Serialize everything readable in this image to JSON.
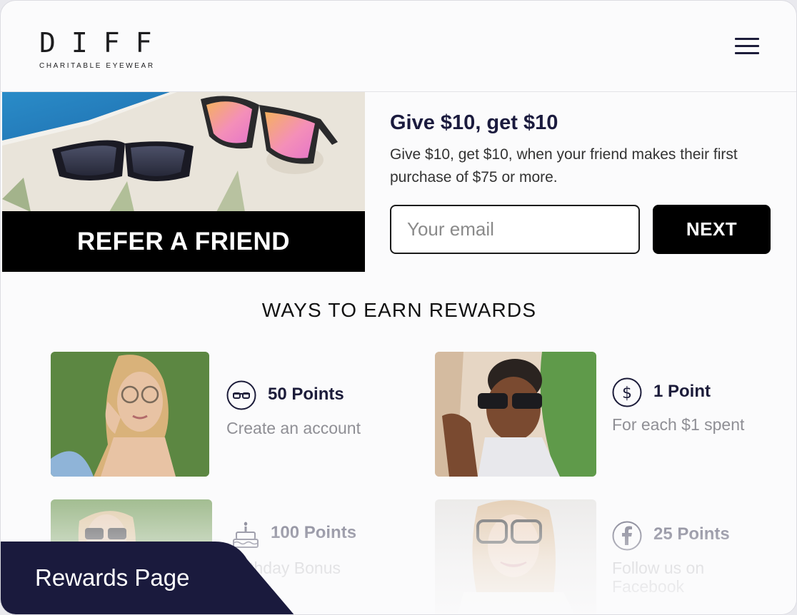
{
  "header": {
    "logo_word": "DIFF",
    "logo_sub": "CHARITABLE EYEWEAR",
    "menu_icon": "hamburger-menu-icon"
  },
  "hero": {
    "banner_text": "REFER A FRIEND",
    "title": "Give $10, get $10",
    "description": "Give $10, get $10, when your friend makes their first purchase of $75 or more.",
    "email_placeholder": "Your email",
    "next_label": "NEXT"
  },
  "rewards": {
    "section_title": "WAYS TO EARN REWARDS",
    "items": [
      {
        "points": "50 Points",
        "description": "Create an account",
        "icon": "glasses-icon"
      },
      {
        "points": "1 Point",
        "description": "For each $1 spent",
        "icon": "dollar-icon"
      },
      {
        "points": "100 Points",
        "description": "Birthday Bonus",
        "icon": "birthday-cake-icon"
      },
      {
        "points": "25 Points",
        "description": "Follow us on Facebook",
        "icon": "facebook-icon"
      }
    ]
  },
  "page_tag": "Rewards Page",
  "colors": {
    "navy": "#1c1c3a",
    "black": "#000000",
    "muted_text": "#8f8f95",
    "tag_bg": "#1a1a3d"
  }
}
